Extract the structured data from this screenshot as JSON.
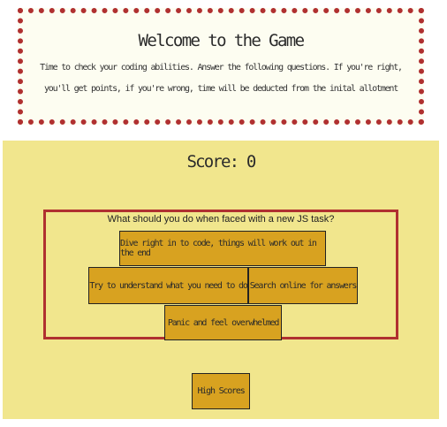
{
  "welcome": {
    "title": "Welcome to the Game",
    "description": "Time to check your coding abilities. Answer the following questions. If you're right, you'll get points, if you're wrong, time will be deducted from the inital allotment"
  },
  "game": {
    "score_label": "Score: 0",
    "question": "What should you do when faced with a new JS task?",
    "answers": [
      "Dive right in to code, things will work out in the end",
      "Try to understand what you need to do",
      "Search online for answers",
      "Panic and feel overwhelmed"
    ],
    "high_scores_label": "High Scores"
  },
  "colors": {
    "border_accent": "#b03030",
    "game_background": "#f1e68d",
    "button_background": "#d8a220",
    "welcome_background": "#fdfdf1"
  }
}
